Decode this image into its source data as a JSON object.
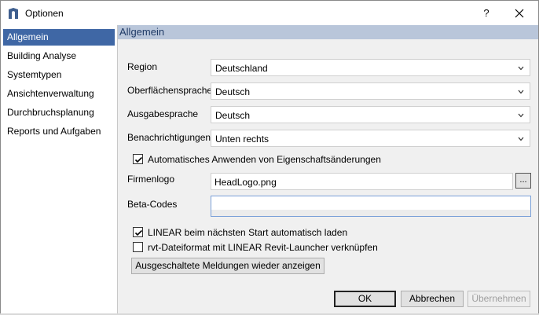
{
  "window": {
    "title": "Optionen",
    "help_label": "?"
  },
  "nav": {
    "items": [
      {
        "label": "Allgemein",
        "selected": true
      },
      {
        "label": "Building Analyse",
        "selected": false
      },
      {
        "label": "Systemtypen",
        "selected": false
      },
      {
        "label": "Ansichtenverwaltung",
        "selected": false
      },
      {
        "label": "Durchbruchsplanung",
        "selected": false
      },
      {
        "label": "Reports und Aufgaben",
        "selected": false
      }
    ]
  },
  "section": {
    "title": "Allgemein"
  },
  "form": {
    "region": {
      "label": "Region",
      "value": "Deutschland"
    },
    "surface_language": {
      "label": "Oberflächensprache",
      "value": "Deutsch"
    },
    "output_language": {
      "label": "Ausgabesprache",
      "value": "Deutsch"
    },
    "notifications": {
      "label": "Benachrichtigungen",
      "value": "Unten rechts"
    },
    "auto_apply": {
      "label": "Automatisches Anwenden von Eigenschaftsänderungen",
      "checked": true
    },
    "company_logo": {
      "label": "Firmenlogo",
      "value": "HeadLogo.png",
      "browse_label": "..."
    },
    "beta_codes": {
      "label": "Beta-Codes",
      "value": ""
    },
    "auto_load": {
      "label": "LINEAR beim nächsten Start automatisch laden",
      "checked": true
    },
    "rvt_link": {
      "label": "rvt-Dateiformat mit LINEAR Revit-Launcher verknüpfen",
      "checked": false
    },
    "show_hidden_label": "Ausgeschaltete Meldungen wieder anzeigen"
  },
  "footer": {
    "ok": "OK",
    "cancel": "Abbrechen",
    "apply": "Übernehmen"
  },
  "colors": {
    "accent": "#3f67a5",
    "section_header": "#b9c6da"
  }
}
